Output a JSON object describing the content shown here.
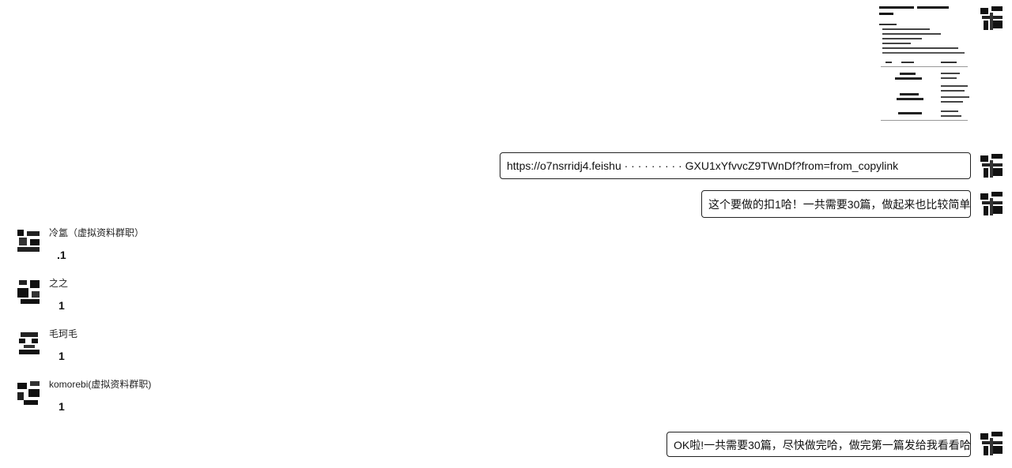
{
  "outgoing": {
    "image_message": {
      "icon": "document-thumbnail"
    },
    "link_message": {
      "text": "https://o7nsrridj4.feishu ·  · ·  · ·  ·  ·  ·  ·     GXU1xYfvvcZ9TWnDf?from=from_copylink"
    },
    "text_message_1": {
      "text": "这个要做的扣1哈！一共需要30篇，做起来也比较简单"
    },
    "text_message_2": {
      "text": "OK啦!一共需要30篇，尽快做完哈，做完第一篇发给我看看哈"
    }
  },
  "incoming": [
    {
      "name": "冷氲（虚拟资料群职）",
      "message": ".1"
    },
    {
      "name": "之之",
      "message": "1"
    },
    {
      "name": "毛珂毛",
      "message": "1"
    },
    {
      "name": "komorebi(虚拟资料群职)",
      "message": "1"
    }
  ],
  "colors": {
    "border": "#222222",
    "background": "#ffffff"
  }
}
